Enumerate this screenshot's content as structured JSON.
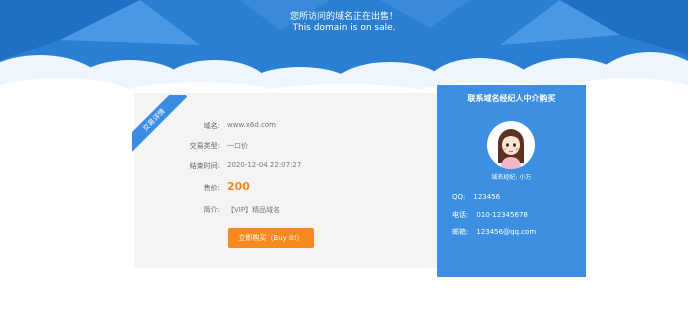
{
  "hero": {
    "title": "您所访问的域名正在出售！",
    "subtitle": "This domain is on sale."
  },
  "listing": {
    "ribbon_label": "交易详情",
    "rows": [
      {
        "label": "域名:",
        "value": "www.x6d.com"
      },
      {
        "label": "交易类型:",
        "value": "一口价"
      },
      {
        "label": "结束时间:",
        "value": "2020-12-04 22:07:27"
      },
      {
        "label": "售价:",
        "value": "200"
      },
      {
        "label": "简介:",
        "value": "【VIP】精品域名"
      }
    ],
    "buy_button": "立即购买（Buy it!）"
  },
  "agent": {
    "title": "联系域名经纪人中介购买",
    "name_label": "域名经纪:",
    "name": "小万",
    "qq_label": "QQ:",
    "qq": "123456",
    "phone_label": "电话:",
    "phone": "010-12345678",
    "email_label": "邮箱:",
    "email": "123456@qq.com"
  },
  "colors": {
    "hero_bg": "#2a7fd2",
    "agent_bg": "#3d8fe1",
    "buy_button": "#f68a1e",
    "price": "#f08a1c"
  }
}
